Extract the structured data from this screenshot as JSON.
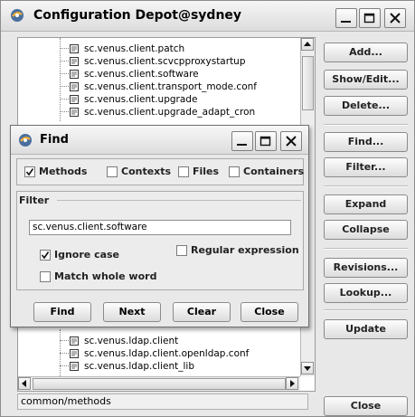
{
  "window": {
    "title": "Configuration Depot@sydney"
  },
  "tree": {
    "top_items": [
      "sc.venus.client.patch",
      "sc.venus.client.scvcpproxystartup",
      "sc.venus.client.software",
      "sc.venus.client.transport_mode.conf",
      "sc.venus.client.upgrade",
      "sc.venus.client.upgrade_adapt_cron"
    ],
    "bottom_items": [
      "sc.venus.ldap.client",
      "sc.venus.ldap.client.openldap.conf",
      "sc.venus.ldap.client_lib"
    ]
  },
  "status": {
    "path": "common/methods"
  },
  "actions": {
    "add": "Add...",
    "show_edit": "Show/Edit...",
    "delete": "Delete...",
    "find": "Find...",
    "filter": "Filter...",
    "expand": "Expand",
    "collapse": "Collapse",
    "revisions": "Revisions...",
    "lookup": "Lookup...",
    "update": "Update",
    "close": "Close"
  },
  "find_dialog": {
    "title": "Find",
    "scopes": [
      {
        "label": "Methods",
        "checked": true
      },
      {
        "label": "Contexts",
        "checked": false
      },
      {
        "label": "Files",
        "checked": false
      },
      {
        "label": "Containers",
        "checked": false
      }
    ],
    "filter_label": "Filter",
    "filter_value": "sc.venus.client.software",
    "ignore_case": {
      "label": "Ignore case",
      "checked": true
    },
    "regex": {
      "label": "Regular expression",
      "checked": false
    },
    "whole_word": {
      "label": "Match whole word",
      "checked": false
    },
    "buttons": {
      "find": "Find",
      "next": "Next",
      "clear": "Clear",
      "close": "Close"
    }
  },
  "icons": {
    "app": "app-icon",
    "file": "file-icon",
    "minimize": "minimize-icon",
    "maximize": "maximize-icon",
    "close": "close-icon"
  }
}
